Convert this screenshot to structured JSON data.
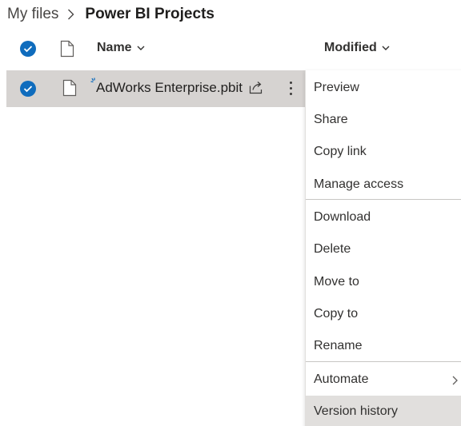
{
  "breadcrumb": {
    "root": "My files",
    "current": "Power BI Projects"
  },
  "header": {
    "name_label": "Name",
    "modified_label": "Modified"
  },
  "file": {
    "name": "AdWorks Enterprise.pbit",
    "selected": true
  },
  "menu": {
    "items": [
      {
        "label": "Preview"
      },
      {
        "label": "Share"
      },
      {
        "label": "Copy link"
      },
      {
        "label": "Manage access"
      },
      {
        "label": "Download"
      },
      {
        "label": "Delete"
      },
      {
        "label": "Move to"
      },
      {
        "label": "Copy to"
      },
      {
        "label": "Rename"
      },
      {
        "label": "Automate",
        "has_submenu": true
      },
      {
        "label": "Version history",
        "highlighted": true
      }
    ]
  },
  "colors": {
    "accent": "#0f6cbd",
    "selected_row": "#d6d3d1",
    "menu_highlight": "#e1dfdd"
  }
}
